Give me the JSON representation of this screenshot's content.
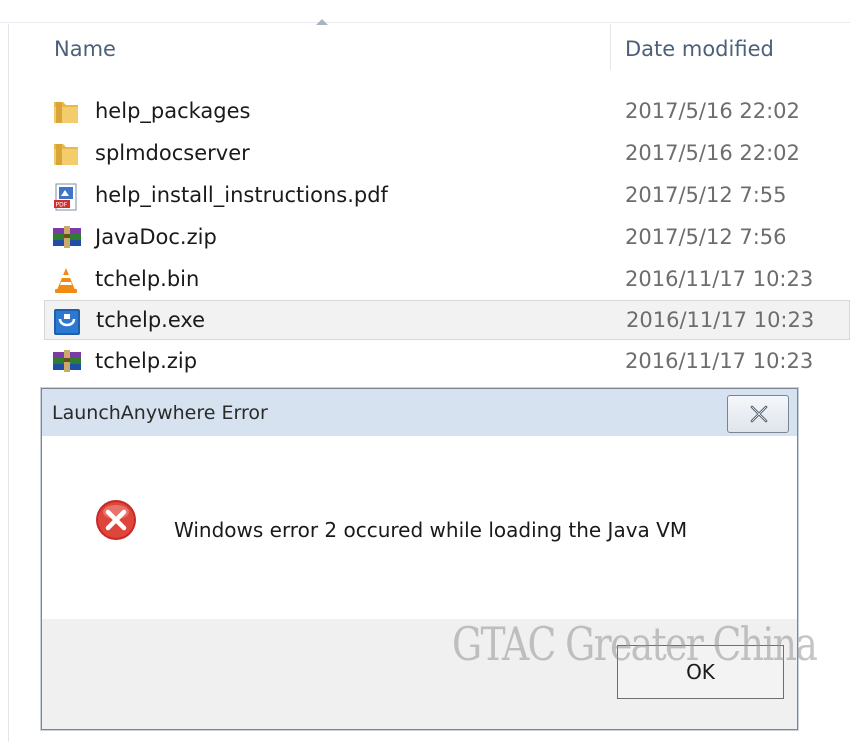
{
  "explorer": {
    "columns": {
      "name": "Name",
      "date_modified": "Date modified"
    },
    "files": [
      {
        "name": "help_packages",
        "date": "2017/5/16 22:02",
        "icon": "folder-icon"
      },
      {
        "name": "splmdocserver",
        "date": "2017/5/16 22:02",
        "icon": "folder-icon"
      },
      {
        "name": "help_install_instructions.pdf",
        "date": "2017/5/12 7:55",
        "icon": "pdf-icon"
      },
      {
        "name": "JavaDoc.zip",
        "date": "2017/5/12 7:56",
        "icon": "archive-icon"
      },
      {
        "name": "tchelp.bin",
        "date": "2016/11/17 10:23",
        "icon": "vlc-cone-icon"
      },
      {
        "name": "tchelp.exe",
        "date": "2016/11/17 10:23",
        "icon": "installer-app-icon",
        "selected": true
      },
      {
        "name": "tchelp.zip",
        "date": "2016/11/17 10:23",
        "icon": "archive-icon"
      }
    ]
  },
  "dialog": {
    "title": "LaunchAnywhere Error",
    "message": "Windows error 2 occured while loading the Java VM",
    "ok_label": "OK",
    "close_glyph": "close-x-icon",
    "error_icon": "error-icon"
  },
  "watermark": "GTAC Greater China",
  "colors": {
    "title_bar": "#d6e2ef",
    "header_text": "#4c607a",
    "error_red": "#d62b2b",
    "selected_row": "#f2f2f2"
  }
}
